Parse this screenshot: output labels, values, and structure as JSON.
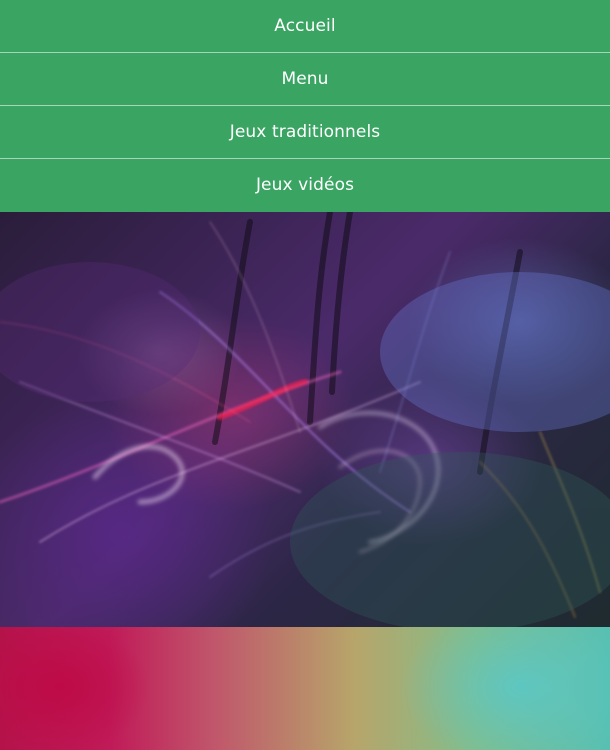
{
  "nav": {
    "items": [
      {
        "label": "Accueil"
      },
      {
        "label": "Menu"
      },
      {
        "label": "Jeux traditionnels"
      },
      {
        "label": "Jeux vidéos"
      }
    ]
  },
  "colors": {
    "nav_background": "#3aa563",
    "nav_text": "#ffffff"
  }
}
